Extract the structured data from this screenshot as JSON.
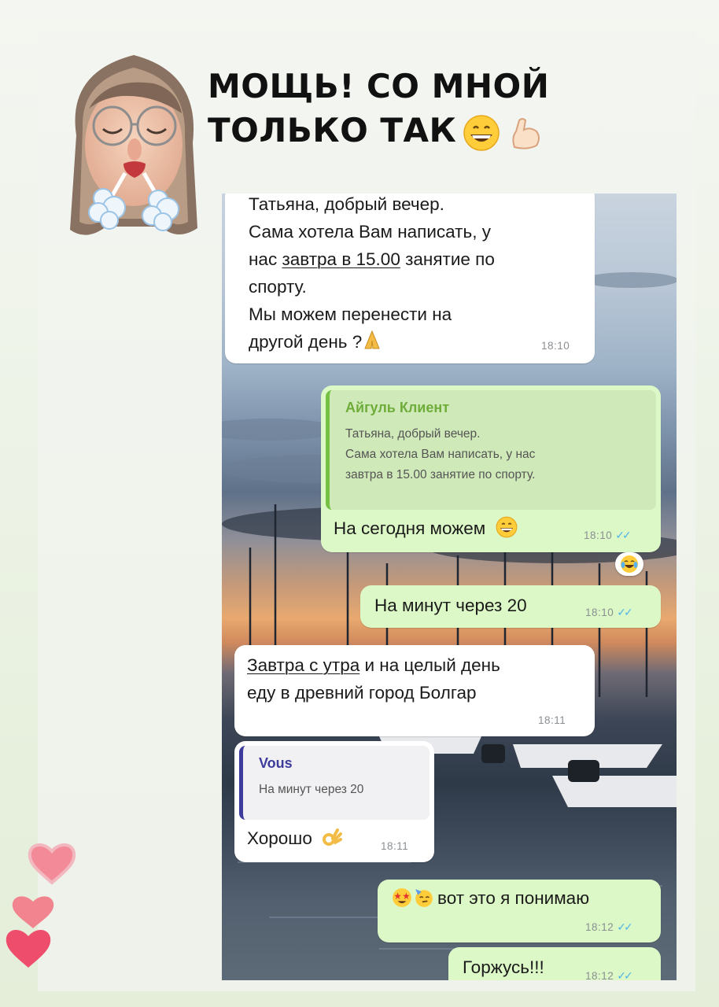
{
  "headline": {
    "line1": "МОЩЬ! СО МНОЙ",
    "line2": "ТОЛЬКО ТАК"
  },
  "messages": [
    {
      "direction": "in",
      "lines": [
        "Татьяна, добрый вечер.",
        "Сама хотела Вам написать, у",
        "нас ",
        "завтра в 15.00",
        " занятие по",
        "спорту.",
        "Мы можем перенести на",
        "другой день ?"
      ],
      "time": "18:10"
    },
    {
      "direction": "out",
      "quote": {
        "author": "Айгуль Клиент",
        "lines": [
          "Татьяна, добрый вечер.",
          "Сама хотела Вам написать, у нас",
          "завтра в 15.00 занятие по спорту."
        ]
      },
      "text": "На сегодня можем",
      "time": "18:10"
    },
    {
      "direction": "out",
      "text": "На минут через 20",
      "time": "18:10"
    },
    {
      "direction": "in",
      "underlined": "Завтра с утра",
      "line1_rest": " и на целый день",
      "line2": "еду в древний город Болгар",
      "time": "18:11"
    },
    {
      "direction": "in",
      "quote": {
        "author": "Vous",
        "text": "На минут через 20"
      },
      "text": "Хорошо",
      "time": "18:11"
    },
    {
      "direction": "out",
      "text": "вот это я понимаю",
      "time": "18:12"
    },
    {
      "direction": "out",
      "text": "Горжусь!!!",
      "time": "18:12"
    }
  ],
  "icons": {
    "avatar": "memoji-glasses-icon",
    "grin": "grinning-face-icon",
    "muscle": "flexed-biceps-icon",
    "pray": "folded-hands-icon",
    "laugh": "tears-of-joy-icon",
    "ok": "ok-hand-icon",
    "starstruck": "star-struck-icon",
    "party": "partying-face-icon",
    "read": "double-check-icon",
    "heart": "heart-icon"
  },
  "colors": {
    "outgoing": "#dcf8c6",
    "incoming": "#ffffff",
    "read_ticks": "#4fb3e8",
    "quote_green": "#76c043",
    "quote_blue": "#3d3b9c",
    "heart": "#f0506e"
  }
}
